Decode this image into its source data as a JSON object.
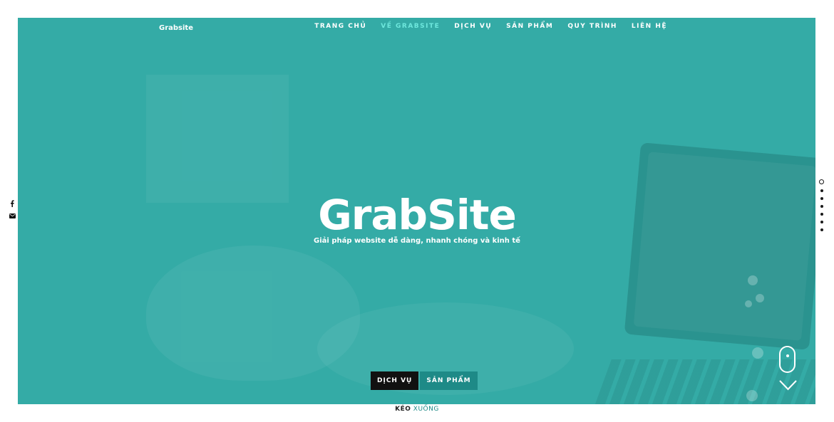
{
  "brand": "Grabsite",
  "nav": {
    "items": [
      {
        "label": "TRANG CHỦ",
        "active": false
      },
      {
        "label": "VỀ GRABSITE",
        "active": true
      },
      {
        "label": "DỊCH VỤ",
        "active": false
      },
      {
        "label": "SẢN PHẨM",
        "active": false
      },
      {
        "label": "QUY TRÌNH",
        "active": false
      },
      {
        "label": "LIÊN HỆ",
        "active": false
      }
    ]
  },
  "hero": {
    "title": "GrabSite",
    "subtitle": "Giải pháp website dễ dàng, nhanh chóng và kinh tế",
    "buttons": {
      "primary": "DỊCH VỤ",
      "secondary": "SẢN PHẨM"
    }
  },
  "social": {
    "icons": [
      "facebook-icon",
      "mail-icon"
    ]
  },
  "section_dots": {
    "count": 7,
    "active_index": 0
  },
  "scroll": {
    "label_part1": "KÉO",
    "label_part2": "XUỐNG"
  },
  "colors": {
    "accent": "#34aba6",
    "nav_active": "#6ee7dd",
    "button_dark": "#111111",
    "button_teal": "#1e8a87"
  }
}
